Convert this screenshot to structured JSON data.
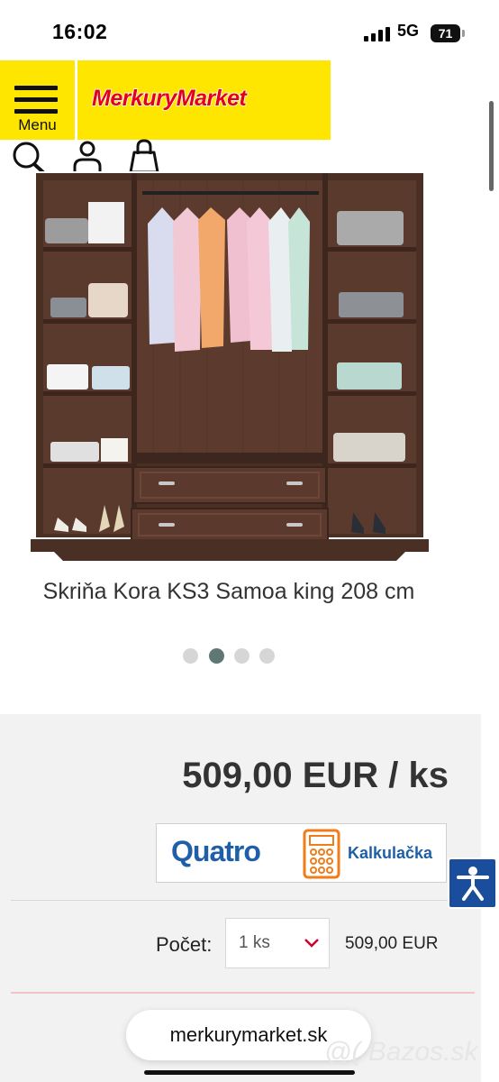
{
  "status_bar": {
    "time": "16:02",
    "network": "5G",
    "battery": "71"
  },
  "header": {
    "menu_label": "Menu",
    "logo_text": "MerkuryMarket",
    "brand_color": "#ffe600",
    "logo_color": "#e2001a"
  },
  "product": {
    "title": "Skriňa Kora KS3 Samoa king 208 cm",
    "image_count": 4,
    "active_image_index": 1,
    "price": "509,00 EUR / ks",
    "quatro": {
      "brand": "Quatro",
      "calculator_label": "Kalkulačka"
    },
    "quantity": {
      "label": "Počet:",
      "selected": "1 ks",
      "total": "509,00 EUR"
    }
  },
  "browser": {
    "url": "merkurymarket.sk"
  },
  "watermark": "@( Bazos.sk",
  "colors": {
    "accent": "#e2001a",
    "dot_active": "#5f7873",
    "accessibility": "#1a4d9b"
  }
}
